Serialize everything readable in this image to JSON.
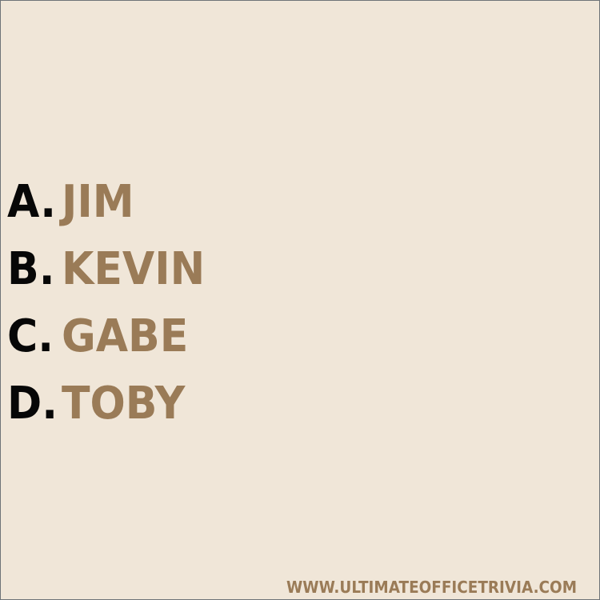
{
  "options": [
    {
      "letter": "A.",
      "answer": "JIM"
    },
    {
      "letter": "B.",
      "answer": "KEVIN"
    },
    {
      "letter": "C.",
      "answer": "GABE"
    },
    {
      "letter": "D.",
      "answer": "TOBY"
    }
  ],
  "footer": {
    "website": "WWW.ULTIMATEOFFICETRIVIA.COM"
  },
  "colors": {
    "background": "#f0e6d8",
    "letter": "#070707",
    "answer": "#9a7b57",
    "border": "#6f7478"
  }
}
